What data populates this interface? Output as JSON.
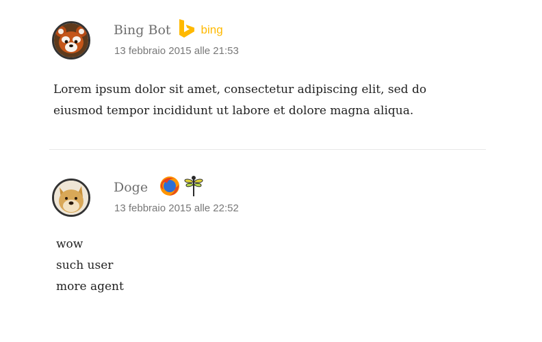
{
  "comments": [
    {
      "author": "Bing Bot",
      "agent": {
        "logo_text": "bing",
        "color": "#ffb900",
        "icon": "bing-icon"
      },
      "date": "13 febbraio 2015 alle 21:53",
      "text": "Lorem ipsum dolor sit amet, consectetur adipiscing elit, sed do eiusmod tempor incididunt ut labore et dolore magna aliqua.",
      "avatar": "red-panda-avatar"
    },
    {
      "author": "Doge",
      "agents": [
        "firefox-icon",
        "dragonfly-icon"
      ],
      "date": "13 febbraio 2015 alle 22:52",
      "lines": [
        "wow",
        "such user",
        "more agent"
      ],
      "avatar": "doge-avatar"
    }
  ]
}
